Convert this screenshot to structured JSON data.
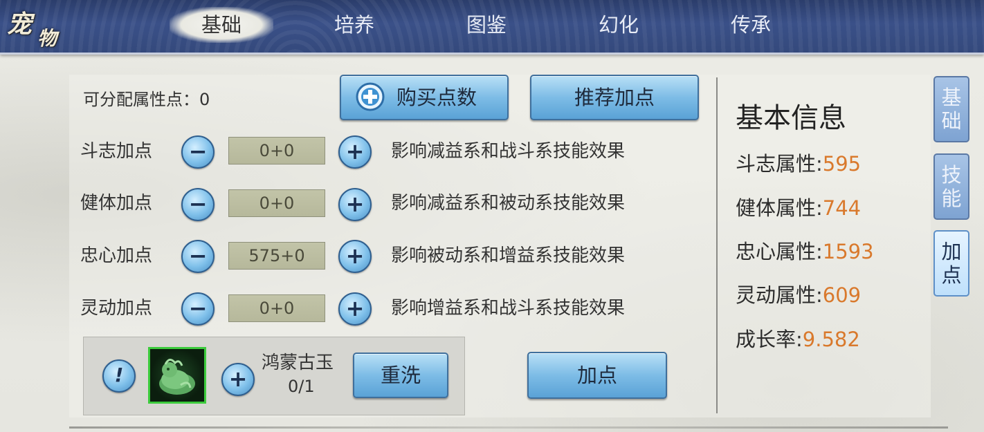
{
  "header": {
    "logo_text": "宠物",
    "tabs": [
      {
        "label": "基础",
        "active": true
      },
      {
        "label": "培养",
        "active": false
      },
      {
        "label": "图鉴",
        "active": false
      },
      {
        "label": "幻化",
        "active": false
      },
      {
        "label": "传承",
        "active": false
      }
    ]
  },
  "points": {
    "available_label": "可分配属性点：",
    "available_value": "0",
    "buy_label": "购买点数",
    "recommend_label": "推荐加点"
  },
  "attributes": [
    {
      "label": "斗志加点",
      "value": "0+0",
      "desc": "影响减益系和战斗系技能效果"
    },
    {
      "label": "健体加点",
      "value": "0+0",
      "desc": "影响减益系和被动系技能效果"
    },
    {
      "label": "忠心加点",
      "value": "575+0",
      "desc": "影响被动系和增益系技能效果"
    },
    {
      "label": "灵动加点",
      "value": "0+0",
      "desc": "影响增益系和战斗系技能效果"
    }
  ],
  "buttons": {
    "minus": "−",
    "plus": "+"
  },
  "reset": {
    "info": "!",
    "item_name": "鸿蒙古玉",
    "item_count": "0/1",
    "reset_label": "重洗",
    "add_label": "加点"
  },
  "info": {
    "title": "基本信息",
    "rows": [
      {
        "label": "斗志属性:",
        "value": "595"
      },
      {
        "label": "健体属性:",
        "value": "744"
      },
      {
        "label": "忠心属性:",
        "value": "1593"
      },
      {
        "label": "灵动属性:",
        "value": "609"
      },
      {
        "label": "成长率:",
        "value": "9.582"
      }
    ]
  },
  "side_tabs": [
    {
      "line1": "基",
      "line2": "础",
      "active": false
    },
    {
      "line1": "技",
      "line2": "能",
      "active": false
    },
    {
      "line1": "加",
      "line2": "点",
      "active": true
    }
  ],
  "colors": {
    "accent_value": "#d9792c",
    "tab_bar": "#34497c",
    "item_border": "#3ccb3c"
  }
}
